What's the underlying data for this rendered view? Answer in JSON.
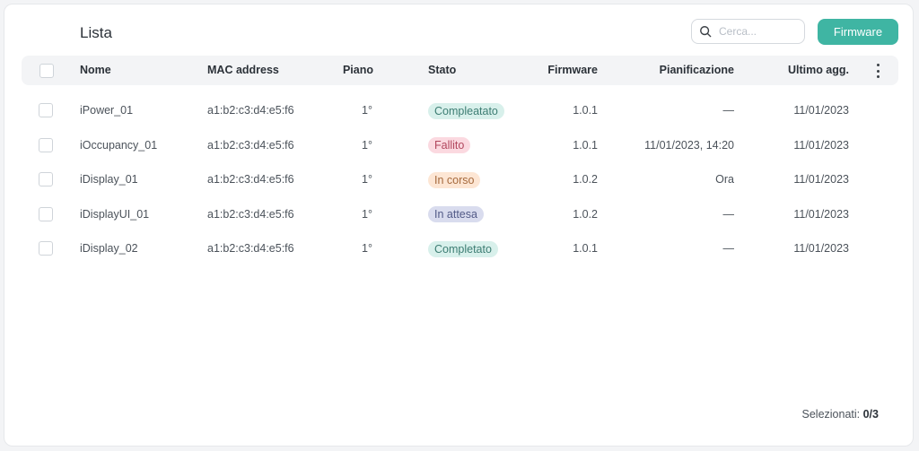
{
  "header": {
    "title": "Lista",
    "search_placeholder": "Cerca...",
    "firmware_button": "Firmware"
  },
  "columns": {
    "name": "Nome",
    "mac": "MAC address",
    "floor": "Piano",
    "status": "Stato",
    "firmware": "Firmware",
    "schedule": "Pianificazione",
    "last_update": "Ultimo agg."
  },
  "rows": [
    {
      "name": "iPower_01",
      "mac": "a1:b2:c3:d4:e5:f6",
      "floor": "1°",
      "status": "Compleatato",
      "status_kind": "done",
      "firmware": "1.0.1",
      "schedule": "—",
      "last_update": "11/01/2023"
    },
    {
      "name": "iOccupancy_01",
      "mac": "a1:b2:c3:d4:e5:f6",
      "floor": "1°",
      "status": "Fallito",
      "status_kind": "failed",
      "firmware": "1.0.1",
      "schedule": "11/01/2023, 14:20",
      "last_update": "11/01/2023"
    },
    {
      "name": "iDisplay_01",
      "mac": "a1:b2:c3:d4:e5:f6",
      "floor": "1°",
      "status": "In corso",
      "status_kind": "progress",
      "firmware": "1.0.2",
      "schedule": "Ora",
      "last_update": "11/01/2023"
    },
    {
      "name": "iDisplayUI_01",
      "mac": "a1:b2:c3:d4:e5:f6",
      "floor": "1°",
      "status": "In attesa",
      "status_kind": "waiting",
      "firmware": "1.0.2",
      "schedule": "—",
      "last_update": "11/01/2023"
    },
    {
      "name": "iDisplay_02",
      "mac": "a1:b2:c3:d4:e5:f6",
      "floor": "1°",
      "status": "Completato",
      "status_kind": "done",
      "firmware": "1.0.1",
      "schedule": "—",
      "last_update": "11/01/2023"
    }
  ],
  "status_colors": {
    "done": {
      "bg": "#d8f0eb",
      "fg": "#3d7d73"
    },
    "failed": {
      "bg": "#fbd9e0",
      "fg": "#b2475e"
    },
    "progress": {
      "bg": "#fde6d4",
      "fg": "#a66a3d"
    },
    "waiting": {
      "bg": "#d9dcee",
      "fg": "#525a87"
    }
  },
  "footer": {
    "label": "Selezionati:",
    "count": "0/3"
  },
  "colors": {
    "accent": "#3fb5a3"
  }
}
